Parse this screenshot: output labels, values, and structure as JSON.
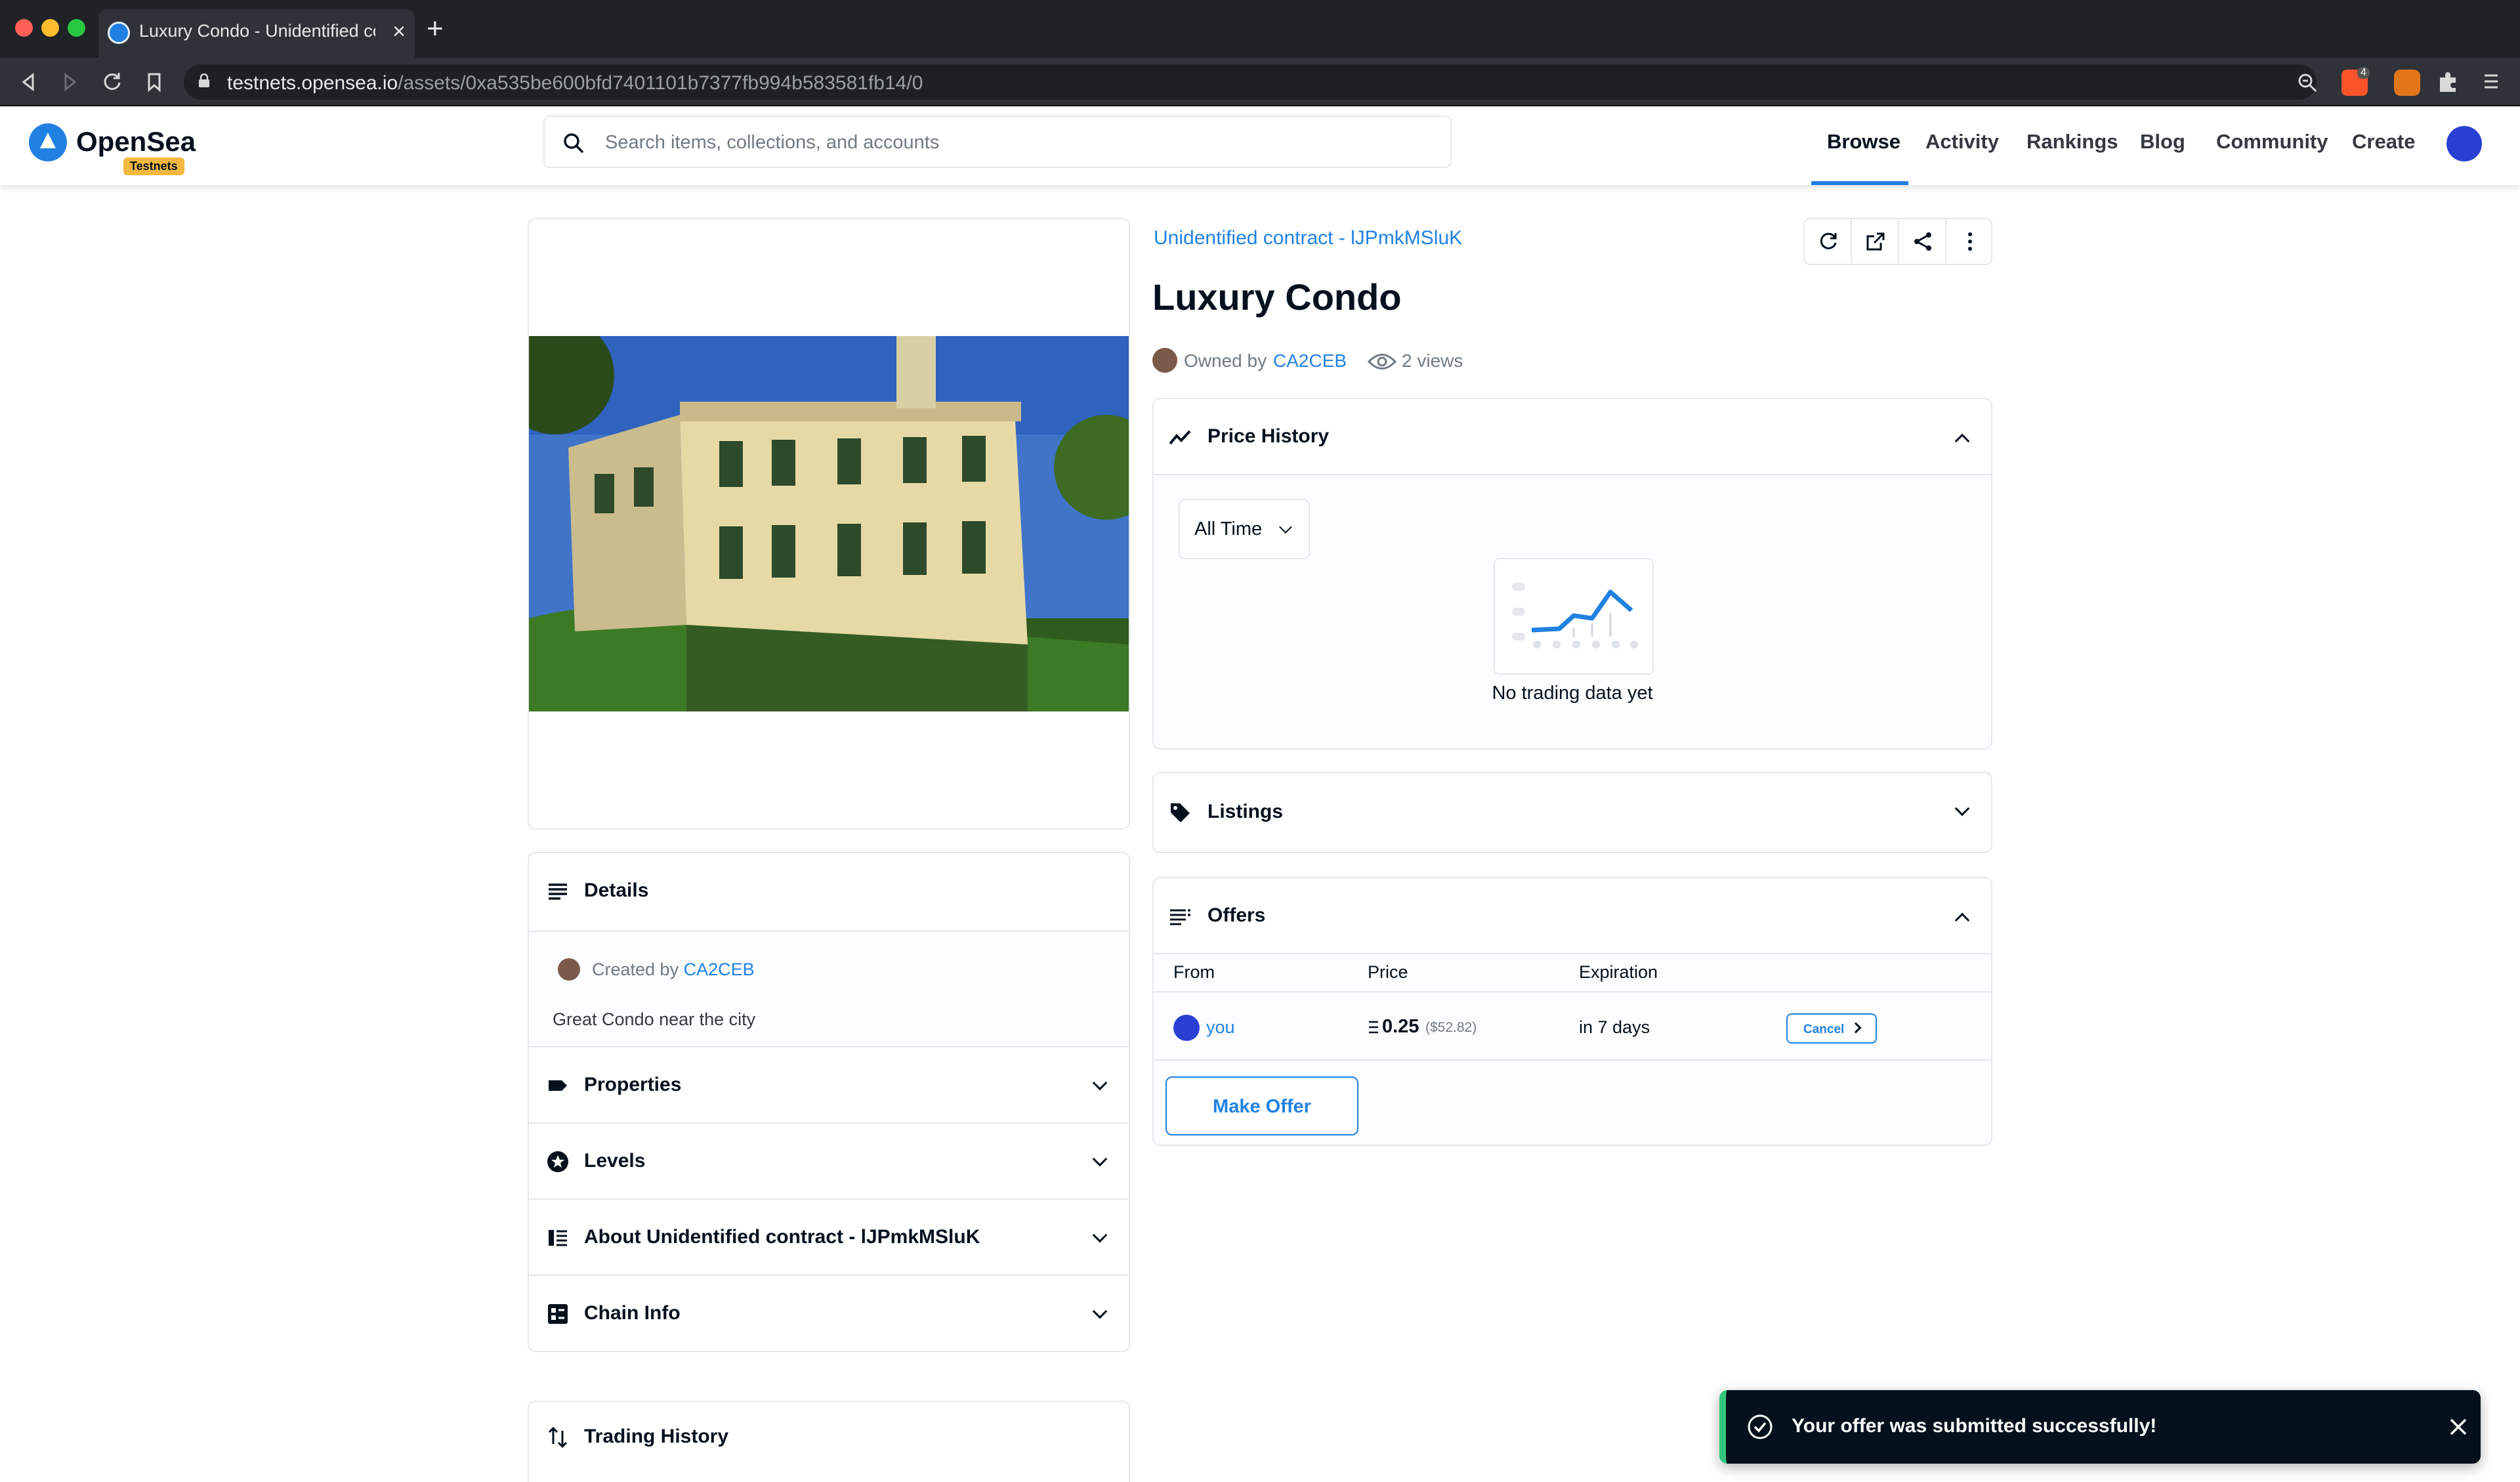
{
  "browser": {
    "tab_title": "Luxury Condo - Unidentified co",
    "url_host": "testnets.opensea.io",
    "url_path": "/assets/0xa535be600bfd7401101b7377fb994b583581fb14/0",
    "extension_badge": "4"
  },
  "header": {
    "logo_text": "OpenSea",
    "badge": "Testnets",
    "search_placeholder": "Search items, collections, and accounts",
    "nav": [
      "Browse",
      "Activity",
      "Rankings",
      "Blog",
      "Community",
      "Create"
    ]
  },
  "asset": {
    "collection": "Unidentified contract - lJPmkMSluK",
    "title": "Luxury Condo",
    "owned_by_label": "Owned by",
    "owner": "CA2CEB",
    "views": "2 views"
  },
  "details": {
    "title": "Details",
    "created_by_label": "Created by",
    "creator": "CA2CEB",
    "description": "Great Condo near the city",
    "sections": [
      "Properties",
      "Levels",
      "About Unidentified contract - lJPmkMSluK",
      "Chain Info"
    ]
  },
  "price_history": {
    "title": "Price History",
    "filter": "All Time",
    "empty": "No trading data yet"
  },
  "listings": {
    "title": "Listings"
  },
  "offers": {
    "title": "Offers",
    "columns": [
      "From",
      "Price",
      "Expiration"
    ],
    "rows": [
      {
        "from": "you",
        "price": "0.25",
        "usd": "($52.82)",
        "expiration": "in 7 days",
        "action": "Cancel"
      }
    ],
    "make_offer": "Make Offer"
  },
  "trading_history": {
    "title": "Trading History"
  },
  "toast": {
    "message": "Your offer was submitted successfully!"
  },
  "colors": {
    "accent": "#2081e2",
    "avatar": "#2940d3",
    "toast_bg": "#04111d",
    "success": "#34c77b"
  }
}
